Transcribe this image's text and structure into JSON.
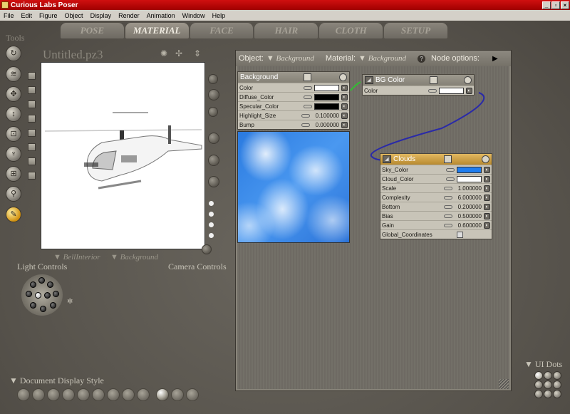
{
  "window": {
    "title": "Curious Labs Poser"
  },
  "menu": [
    "File",
    "Edit",
    "Figure",
    "Object",
    "Display",
    "Render",
    "Animation",
    "Window",
    "Help"
  ],
  "tabs": [
    {
      "label": "POSE",
      "active": false
    },
    {
      "label": "MATERIAL",
      "active": true
    },
    {
      "label": "FACE",
      "active": false
    },
    {
      "label": "HAIR",
      "active": false
    },
    {
      "label": "CLOTH",
      "active": false
    },
    {
      "label": "SETUP",
      "active": false
    }
  ],
  "tools": {
    "label": "Tools"
  },
  "document": {
    "name": "Untitled.pz3",
    "camera_dropdown": "BellInterior",
    "figure_dropdown": "Background"
  },
  "light_controls": {
    "label": "Light Controls"
  },
  "camera_controls": {
    "label": "Camera Controls"
  },
  "display_style": {
    "label": "Document Display Style"
  },
  "ui_dots": {
    "label": "UI Dots"
  },
  "material_room": {
    "object_label": "Object:",
    "object_value": "Background",
    "material_label": "Material:",
    "material_value": "Background",
    "node_options_label": "Node options:"
  },
  "nodes": {
    "background": {
      "title": "Background",
      "rows": [
        {
          "name": "Color",
          "color": "#ffffff"
        },
        {
          "name": "Diffuse_Color",
          "color": "#000000"
        },
        {
          "name": "Specular_Color",
          "color": "#000000"
        },
        {
          "name": "Highlight_Size",
          "value": "0.100000"
        },
        {
          "name": "Bump",
          "value": "0.000000"
        }
      ]
    },
    "bgcolor": {
      "title": "BG Color",
      "rows": [
        {
          "name": "Color",
          "color": "#ffffff"
        }
      ]
    },
    "clouds": {
      "title": "Clouds",
      "rows": [
        {
          "name": "Sky_Color",
          "color": "#1e7df0"
        },
        {
          "name": "Cloud_Color",
          "color": "#ffffff"
        },
        {
          "name": "Scale",
          "value": "1.000000"
        },
        {
          "name": "Complexity",
          "value": "6.000000"
        },
        {
          "name": "Bottom",
          "value": "0.200000"
        },
        {
          "name": "Bias",
          "value": "0.500000"
        },
        {
          "name": "Gain",
          "value": "0.600000"
        },
        {
          "name": "Global_Coordinates",
          "checkbox": true
        }
      ]
    }
  }
}
